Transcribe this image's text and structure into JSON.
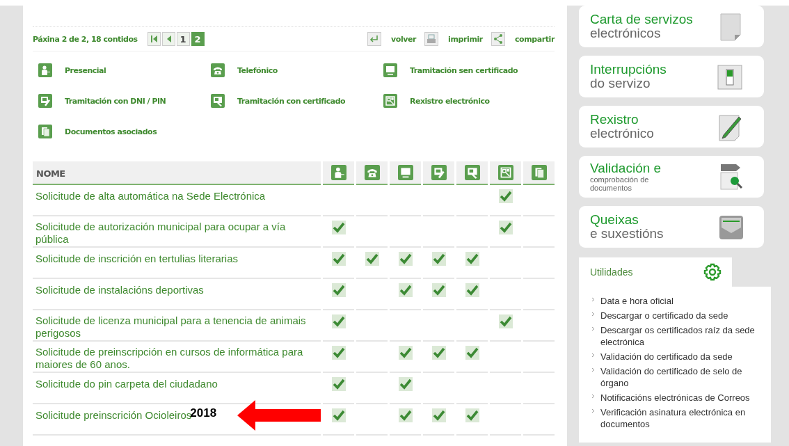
{
  "pager": {
    "summary": "Páxina 2 de 2, 18 contidos",
    "pages": [
      {
        "label": "1",
        "selected": false
      },
      {
        "label": "2",
        "selected": true
      }
    ]
  },
  "actions": [
    {
      "kind": "back",
      "label": "volver"
    },
    {
      "kind": "print",
      "label": "imprimir"
    },
    {
      "kind": "share",
      "label": "compartir"
    }
  ],
  "legend": [
    {
      "kind": "person",
      "label": "Presencial"
    },
    {
      "kind": "phone",
      "label": "Telefónico"
    },
    {
      "kind": "monitor",
      "label": "Tramitación sen certificado"
    },
    {
      "kind": "pin",
      "label": "Tramitación con DNI / PIN"
    },
    {
      "kind": "cert",
      "label": "Tramitación con certificado"
    },
    {
      "kind": "register",
      "label": "Rexistro electrónico"
    },
    {
      "kind": "docs",
      "label": "Documentos asociados"
    }
  ],
  "table": {
    "name_header": "NOME",
    "columns": [
      {
        "kind": "person"
      },
      {
        "kind": "phone"
      },
      {
        "kind": "monitor"
      },
      {
        "kind": "pin"
      },
      {
        "kind": "cert"
      },
      {
        "kind": "register"
      },
      {
        "kind": "docs"
      }
    ],
    "rows": [
      {
        "name": "Solicitude de alta automática na Sede Electrónica",
        "checks": [
          false,
          false,
          false,
          false,
          false,
          true,
          false
        ]
      },
      {
        "name": "Solicitude de autorización municipal para ocupar a vía pública",
        "checks": [
          true,
          false,
          false,
          false,
          false,
          true,
          false
        ]
      },
      {
        "name": "Solicitude de inscrición en tertulias literarias",
        "checks": [
          true,
          true,
          true,
          true,
          true,
          false,
          false
        ]
      },
      {
        "name": "Solicitude de instalacións deportivas",
        "checks": [
          true,
          false,
          true,
          true,
          true,
          false,
          false
        ]
      },
      {
        "name": "Solicitude de licenza municipal para a tenencia de animais perigosos",
        "checks": [
          true,
          false,
          false,
          false,
          false,
          true,
          false
        ]
      },
      {
        "name": "Solicitude de preinscripción en cursos de informática para maiores de 60 anos.",
        "checks": [
          true,
          false,
          true,
          true,
          true,
          false,
          false
        ]
      },
      {
        "name": "Solicitude do pin carpeta del ciudadano",
        "checks": [
          true,
          false,
          true,
          false,
          false,
          false,
          false
        ]
      },
      {
        "name": "Solicitude preinscrición Ocioleiros",
        "checks": [
          true,
          false,
          true,
          true,
          true,
          false,
          false
        ],
        "annotation": "2018"
      }
    ]
  },
  "side_cards": [
    {
      "kind": "document",
      "title": "Carta de servizos",
      "subtitle": "electrónicos"
    },
    {
      "kind": "switch",
      "title": "Interrupcións",
      "subtitle": "do servizo"
    },
    {
      "kind": "pen",
      "title": "Rexistro",
      "subtitle": "electrónico"
    },
    {
      "kind": "validate",
      "title": "Validación e",
      "subtitle": "comprobación de documentos",
      "small": true
    },
    {
      "kind": "mail",
      "title": "Queixas",
      "subtitle": "e suxestións"
    }
  ],
  "utilities": {
    "title": "Utilidades",
    "items": [
      "Data e hora oficial",
      "Descargar o certificado da sede",
      "Descargar os certificados raíz da sede electrónica",
      "Validación do certificado da sede",
      "Validación do certificado de selo de órgano",
      "Notificacións electrónicas de Correos",
      "Verificación asinatura electrónica en documentos"
    ]
  }
}
